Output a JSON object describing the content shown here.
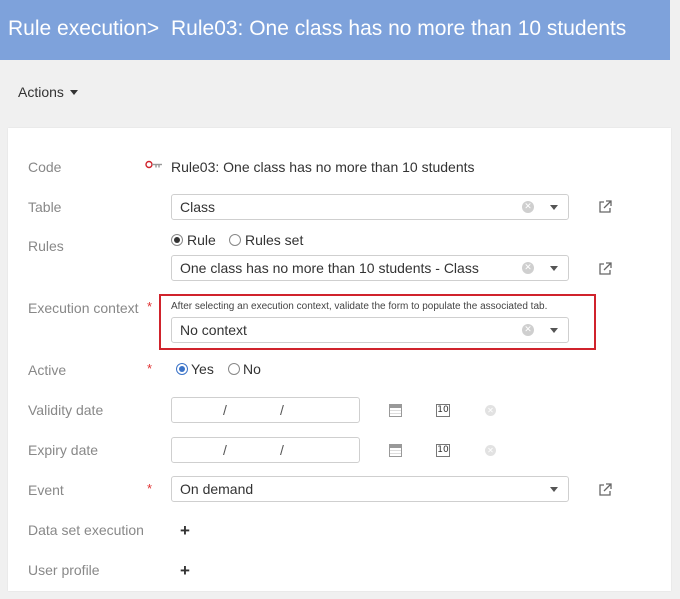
{
  "header": {
    "breadcrumb": "Rule execution>",
    "title": "Rule03: One class has no more than 10 students"
  },
  "toolbar": {
    "actions_label": "Actions"
  },
  "form": {
    "code": {
      "label": "Code",
      "value": "Rule03: One class has no more than 10 students",
      "icon": "code-key-icon"
    },
    "table": {
      "label": "Table",
      "value": "Class"
    },
    "rules": {
      "label": "Rules",
      "options": [
        "Rule",
        "Rules set"
      ],
      "selected": "Rule",
      "value": "One class has no more than 10 students - Class"
    },
    "execution_context": {
      "label": "Execution context",
      "required_mark": "*",
      "hint": "After selecting an execution context, validate the form to populate the associated tab.",
      "value": "No context",
      "highlight_color": "#d0232c"
    },
    "active": {
      "label": "Active",
      "required_mark": "*",
      "options": [
        "Yes",
        "No"
      ],
      "selected": "Yes"
    },
    "validity_date": {
      "label": "Validity date",
      "separator": "/",
      "calendar_day": "10"
    },
    "expiry_date": {
      "label": "Expiry date",
      "separator": "/",
      "calendar_day": "10"
    },
    "event": {
      "label": "Event",
      "required_mark": "*",
      "value": "On demand"
    },
    "data_set_execution": {
      "label": "Data set execution",
      "add_symbol": "+"
    },
    "user_profile": {
      "label": "User profile",
      "add_symbol": "+"
    }
  },
  "colors": {
    "header_bg": "#7ea2db",
    "accent": "#3b73c8",
    "required": "#e03030"
  }
}
